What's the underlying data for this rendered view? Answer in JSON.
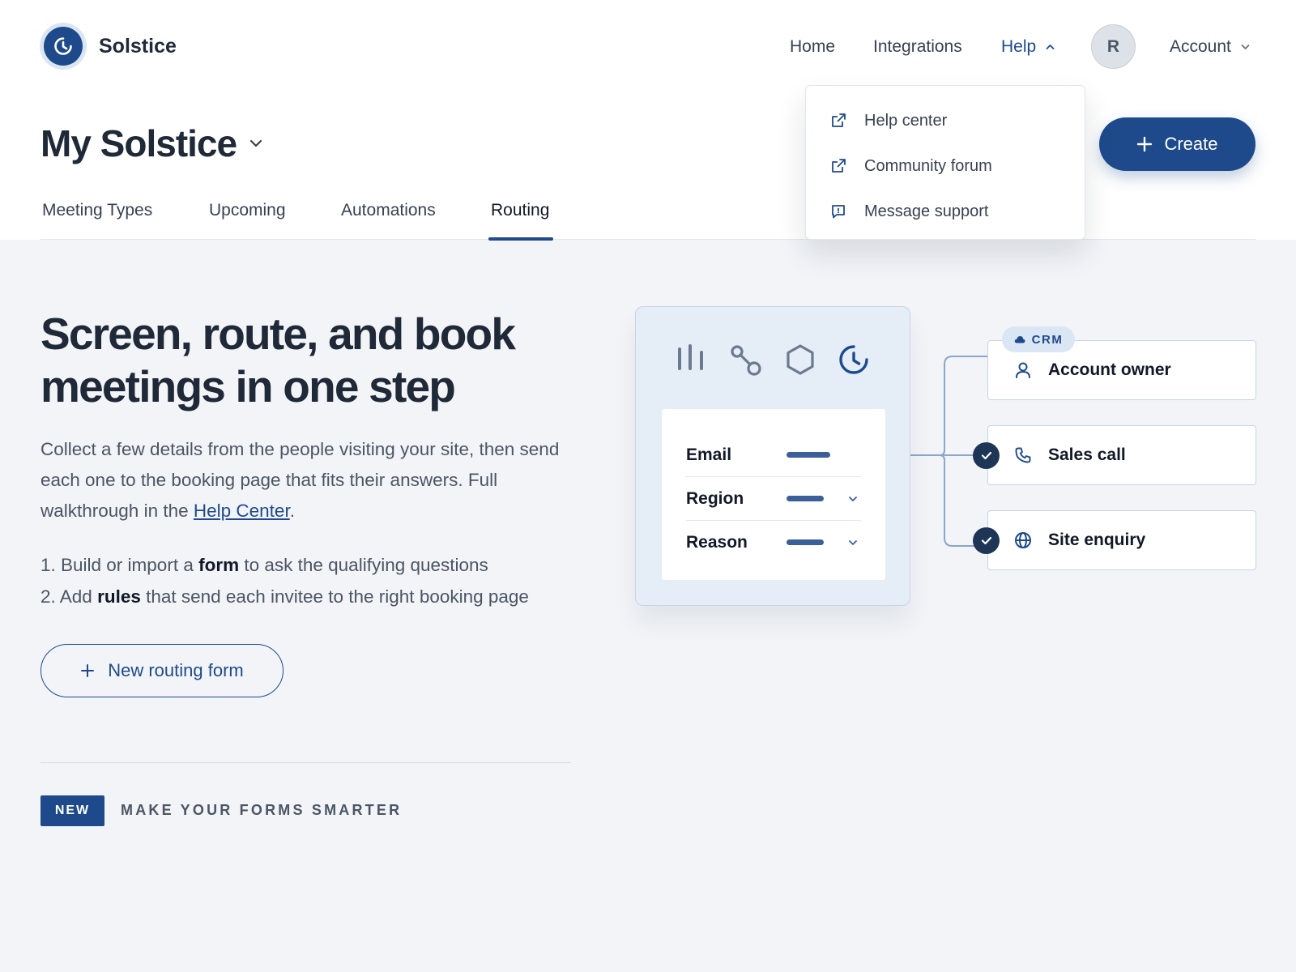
{
  "app": {
    "brand_name": "Solstice",
    "workspace_title": "My Solstice",
    "accent_color": "#1e4a8c"
  },
  "header": {
    "nav": {
      "home": "Home",
      "integrations": "Integrations",
      "help": "Help",
      "account": "Account"
    },
    "avatar_initial": "R",
    "create_label": "Create",
    "help_menu": [
      {
        "label": "Help center",
        "icon": "external-link-icon"
      },
      {
        "label": "Community forum",
        "icon": "external-link-icon"
      },
      {
        "label": "Message support",
        "icon": "chat-bubble-icon"
      }
    ]
  },
  "tabs": [
    {
      "label": "Meeting Types",
      "active": false
    },
    {
      "label": "Upcoming",
      "active": false
    },
    {
      "label": "Automations",
      "active": false
    },
    {
      "label": "Routing",
      "active": true
    }
  ],
  "main": {
    "headline": "Screen, route, and book meetings in one step",
    "description_before_link": "Collect a few details from the people visiting your site, then send each one to the booking page that fits their answers. Full walkthrough in the ",
    "description_link": "Help Center",
    "description_after_link": ".",
    "steps": [
      {
        "prefix": "1. Build or import a ",
        "bold": "form",
        "suffix": " to ask the qualifying questions"
      },
      {
        "prefix": "2. Add ",
        "bold": "rules",
        "suffix": " that send each invitee to the right booking page"
      }
    ],
    "new_form_label": "New routing form",
    "new_badge": "NEW",
    "promo_text": "MAKE YOUR FORMS SMARTER"
  },
  "illustration": {
    "card_icons": [
      "bars-icon",
      "route-icon",
      "hexagon-icon",
      "solstice-logo-icon"
    ],
    "form_fields": [
      {
        "label": "Email",
        "has_dropdown": false
      },
      {
        "label": "Region",
        "has_dropdown": true
      },
      {
        "label": "Reason",
        "has_dropdown": true
      }
    ],
    "crm_tag": "CRM",
    "routes": [
      {
        "label": "Account owner",
        "icon": "person-icon",
        "checked": false
      },
      {
        "label": "Sales call",
        "icon": "phone-icon",
        "checked": true
      },
      {
        "label": "Site enquiry",
        "icon": "globe-icon",
        "checked": true
      }
    ]
  }
}
